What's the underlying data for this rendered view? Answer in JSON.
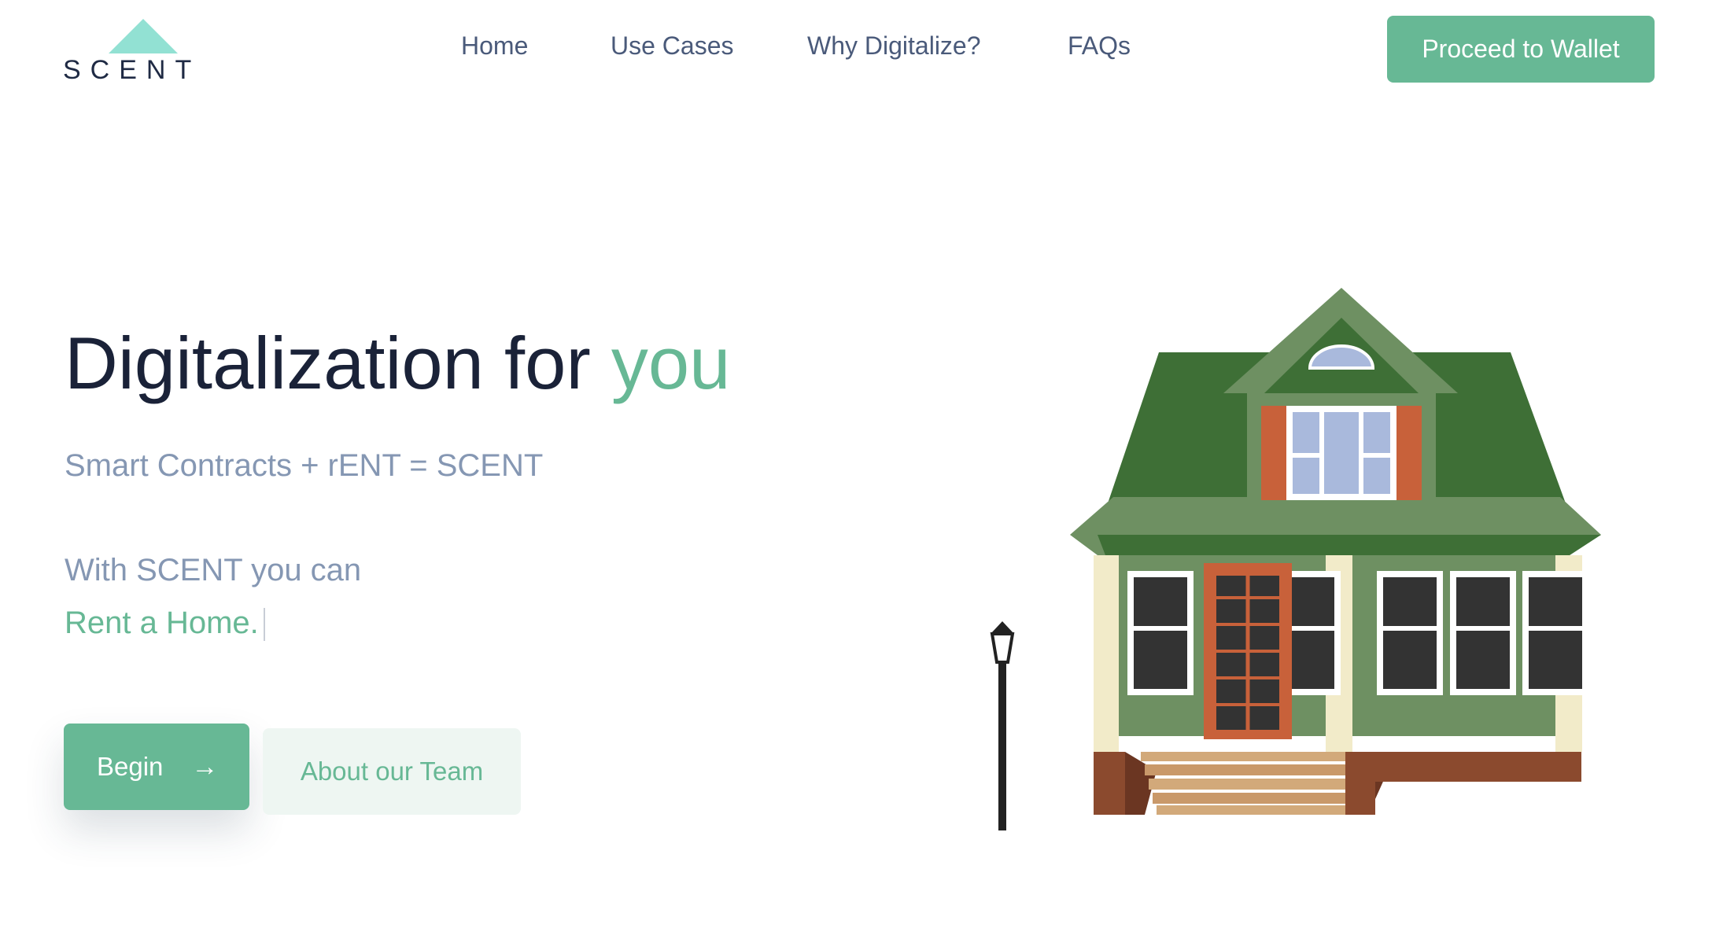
{
  "brand": {
    "logo_text": "SCENT",
    "logo_color": "#92e1d3"
  },
  "nav": {
    "items": [
      {
        "label": "Home"
      },
      {
        "label": "Use Cases"
      },
      {
        "label": "Why Digitalize?"
      },
      {
        "label": "FAQs"
      }
    ],
    "wallet_button": "Proceed to Wallet"
  },
  "hero": {
    "title_prefix": "Digitalization for ",
    "title_accent": "you",
    "subtitle": "Smart Contracts + rENT = SCENT",
    "intro": "With SCENT you can",
    "typed_text": "Rent a Home."
  },
  "actions": {
    "begin_label": "Begin",
    "begin_icon": "arrow-right-icon",
    "team_label": "About our Team"
  },
  "colors": {
    "accent": "#67b895",
    "heading": "#1a2238",
    "muted": "#8597b3",
    "nav": "#4a5a7a"
  }
}
